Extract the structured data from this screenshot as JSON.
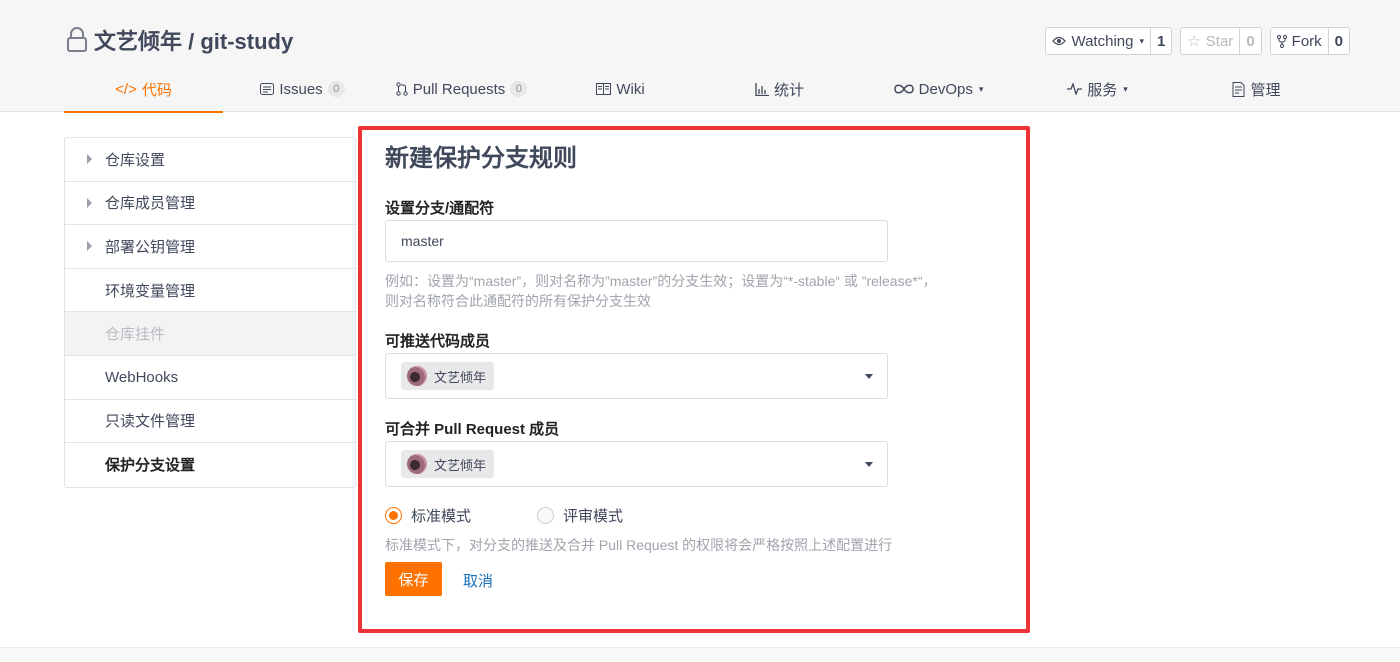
{
  "repo": {
    "title": "文艺倾年 / git-study"
  },
  "actions": {
    "watch_label": "Watching",
    "watch_count": "1",
    "star_label": "Star",
    "star_count": "0",
    "fork_label": "Fork",
    "fork_count": "0"
  },
  "nav": {
    "code": "代码",
    "issues": "Issues",
    "issues_count": "0",
    "pulls": "Pull Requests",
    "pulls_count": "0",
    "wiki": "Wiki",
    "stats": "统计",
    "devops": "DevOps",
    "service": "服务",
    "manage": "管理"
  },
  "sidebar": {
    "items": [
      {
        "label": "仓库设置"
      },
      {
        "label": "仓库成员管理"
      },
      {
        "label": "部署公钥管理"
      },
      {
        "label": "环境变量管理"
      },
      {
        "label": "仓库挂件"
      },
      {
        "label": "WebHooks"
      },
      {
        "label": "只读文件管理"
      },
      {
        "label": "保护分支设置"
      }
    ]
  },
  "form": {
    "title": "新建保护分支规则",
    "branch_label": "设置分支/通配符",
    "branch_value": "master",
    "hint_line1": "例如：设置为“master”，则对名称为”master”的分支生效；设置为“*-stable“ 或 ”release*“，",
    "hint_line2": "则对名称符合此通配符的所有保护分支生效",
    "push_label": "可推送代码成员",
    "push_member": "文艺倾年",
    "merge_label": "可合并 Pull Request 成员",
    "merge_member": "文艺倾年",
    "mode_standard": "标准模式",
    "mode_review": "评审模式",
    "mode_hint": "标准模式下，对分支的推送及合并 Pull Request 的权限将会严格按照上述配置进行",
    "save": "保存",
    "cancel": "取消"
  },
  "colors": {
    "accent": "#fe7300",
    "highlight_border": "#ee3338",
    "link": "#1a6fb8"
  }
}
